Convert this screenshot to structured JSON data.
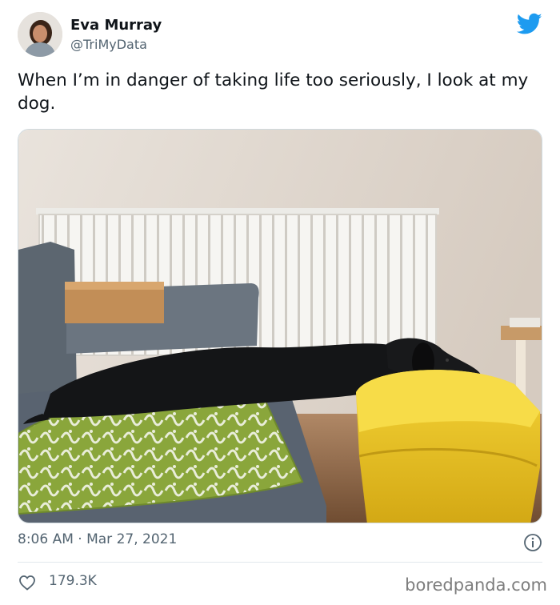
{
  "author": {
    "display_name": "Eva Murray",
    "handle": "@TriMyData",
    "avatar_icon": "avatar"
  },
  "brand": {
    "icon": "twitter-bird-icon",
    "color": "#1d9bf0"
  },
  "tweet": {
    "text": "When I’m in danger of taking life too seriously, I look at my dog.",
    "timestamp": "8:06 AM · Mar 27, 2021",
    "likes": "179.3K"
  },
  "photo": {
    "icon": "dog-photo"
  },
  "footer": {
    "watermark": "boredpanda.com"
  },
  "colors": {
    "text": "#0f1419",
    "secondary": "#536471",
    "divider": "#e1e8ed",
    "cushion": "#f4c91e"
  }
}
